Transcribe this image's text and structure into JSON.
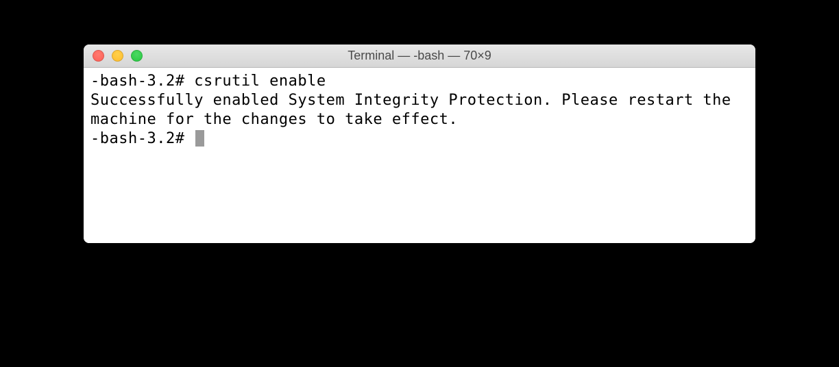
{
  "window": {
    "title": "Terminal — -bash — 70×9"
  },
  "terminal": {
    "lines": [
      "-bash-3.2# csrutil enable",
      "Successfully enabled System Integrity Protection. Please restart the machine for the changes to take effect.",
      "-bash-3.2# "
    ]
  },
  "icons": {
    "close": "close-icon",
    "minimize": "minimize-icon",
    "zoom": "zoom-icon"
  }
}
